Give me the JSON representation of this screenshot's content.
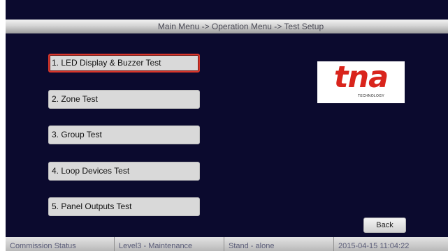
{
  "breadcrumb": "Main Menu -> Operation Menu -> Test Setup",
  "menu": {
    "items": [
      {
        "label": "1. LED Display & Buzzer Test",
        "selected": true
      },
      {
        "label": "2. Zone Test",
        "selected": false
      },
      {
        "label": "3. Group Test",
        "selected": false
      },
      {
        "label": "4. Loop Devices Test",
        "selected": false
      },
      {
        "label": "5. Panel Outputs Test",
        "selected": false
      }
    ]
  },
  "logo": {
    "text": "tna",
    "subtext": "TECHNOLOGY",
    "color": "#d9241c"
  },
  "back_label": "Back",
  "status": {
    "commission": "Commission Status",
    "level": "Level3 - Maintenance",
    "mode": "Stand - alone",
    "datetime": "2015-04-15 11:04:22"
  },
  "colors": {
    "background": "#0b0a2e",
    "selection_border": "#d9362b"
  }
}
